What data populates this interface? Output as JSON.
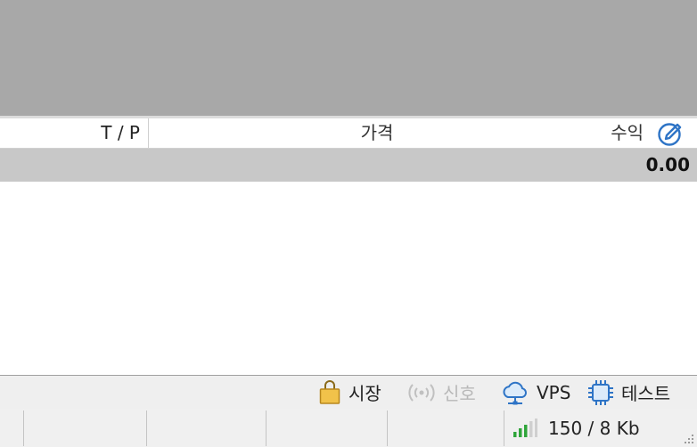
{
  "table": {
    "header": {
      "tp": "T / P",
      "price": "가격",
      "profit": "수익"
    },
    "total_profit": "0.00"
  },
  "tabs": [
    {
      "label": "시장",
      "icon": "shopping-bag-icon",
      "enabled": true
    },
    {
      "label": "신호",
      "icon": "broadcast-icon",
      "enabled": false
    },
    {
      "label": "VPS",
      "icon": "cloud-network-icon",
      "enabled": true
    },
    {
      "label": "테스트",
      "icon": "chip-icon",
      "enabled": true
    }
  ],
  "status_bar": {
    "traffic": "150 / 8 Kb",
    "signal_icon": "signal-strength-icon"
  },
  "colors": {
    "accent_blue": "#2e74c6",
    "market_gold": "#e8b33a",
    "signal_green": "#2fa53a"
  }
}
